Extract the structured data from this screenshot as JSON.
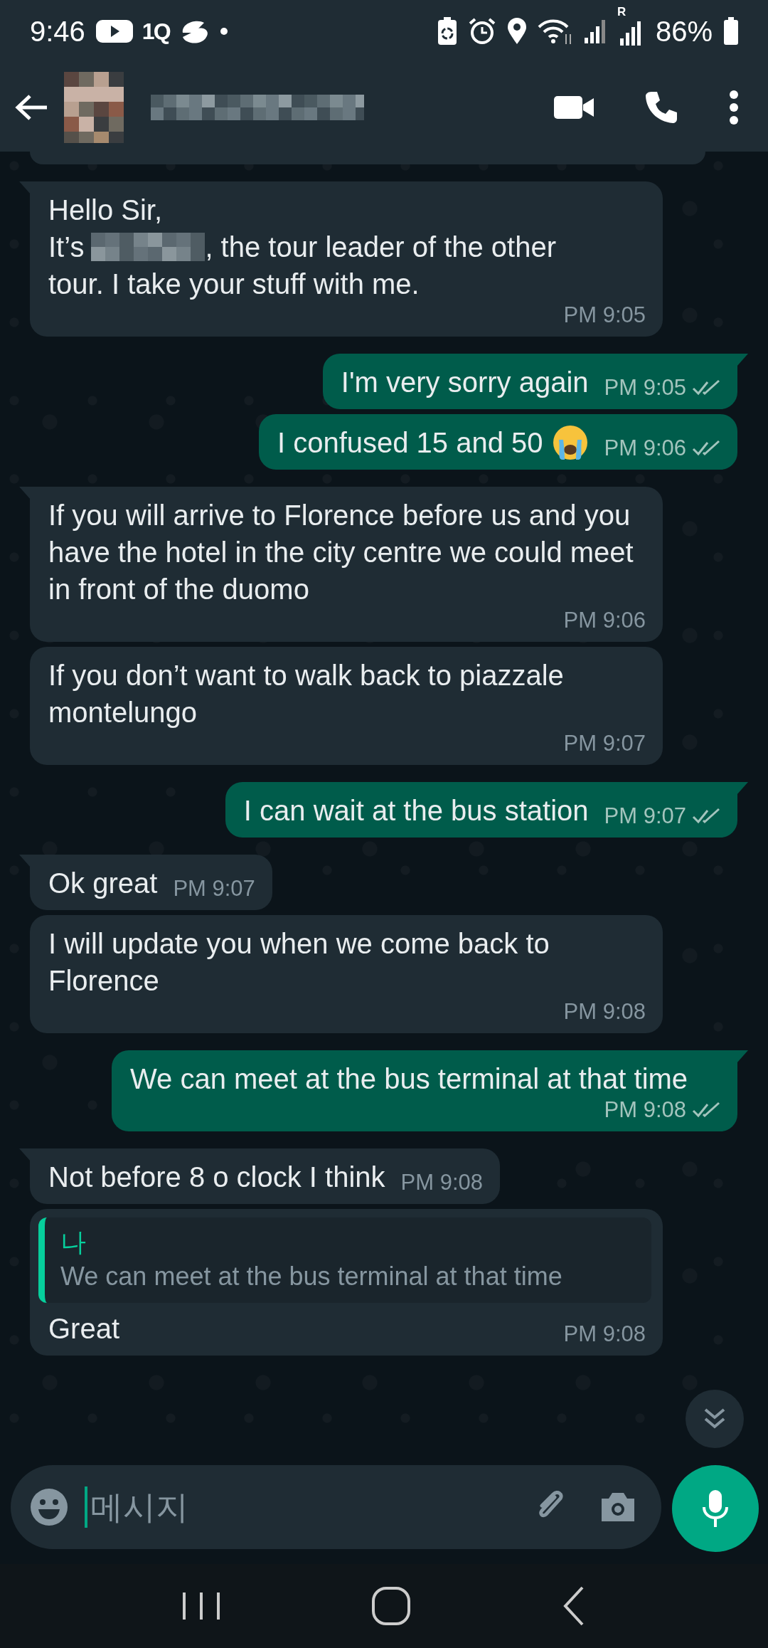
{
  "status_bar": {
    "time": "9:46",
    "app_badge": "1Q",
    "roaming_label": "R",
    "battery": "86%"
  },
  "header": {
    "name_redacted": true
  },
  "messages": [
    {
      "kind": "incoming",
      "tail": true,
      "text": "Hello Sir,",
      "redacted_before": "It’s",
      "redacted": true,
      "redacted_after": ", the tour leader of the other",
      "text_after": "tour. I take your stuff with me.",
      "time": "PM 9:05"
    },
    {
      "kind": "outgoing",
      "tail": true,
      "text": "I'm very sorry again",
      "time": "PM 9:05",
      "read": false
    },
    {
      "kind": "outgoing",
      "tail": false,
      "text": "I confused 15 and 50",
      "emoji": true,
      "time": "PM 9:06",
      "read": false
    },
    {
      "kind": "incoming",
      "tail": true,
      "text": "If you will arrive to Florence  before us and you have the hotel in the city centre we could meet in front of the duomo",
      "time": "PM 9:06"
    },
    {
      "kind": "incoming",
      "tail": false,
      "text": "If you don’t want to walk back to piazzale montelungo",
      "time": "PM 9:07"
    },
    {
      "kind": "outgoing",
      "tail": true,
      "text": "I can wait at the bus station",
      "time": "PM 9:07",
      "read": false
    },
    {
      "kind": "incoming",
      "tail": true,
      "text": "Ok great",
      "time": "PM 9:07"
    },
    {
      "kind": "incoming",
      "tail": false,
      "text": "I will update you when we come back to Florence",
      "time": "PM 9:08"
    },
    {
      "kind": "outgoing",
      "tail": true,
      "text": "We can meet at the bus terminal at that time",
      "time": "PM 9:08",
      "read": false
    },
    {
      "kind": "incoming",
      "tail": true,
      "text": "Not before 8 o clock I think",
      "time": "PM 9:08"
    },
    {
      "kind": "incoming",
      "tail": false,
      "reply": {
        "author": "나",
        "text": "We can meet at the bus terminal at that time"
      },
      "text": "Great",
      "time": "PM 9:08"
    }
  ],
  "composer": {
    "placeholder": "메시지",
    "focused": true
  }
}
